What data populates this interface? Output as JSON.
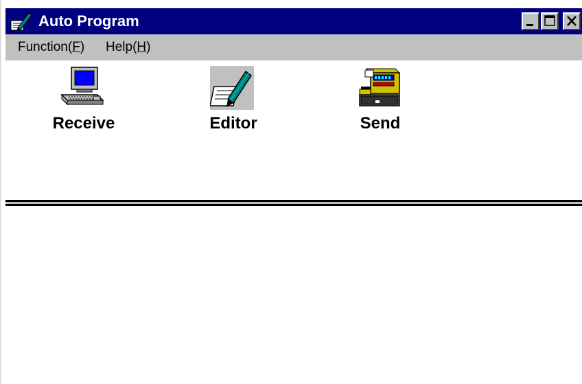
{
  "window": {
    "title": "Auto Program",
    "title_color": "#000080"
  },
  "menu": {
    "function_label": "Function(",
    "function_hotkey": "F",
    "function_close": ")",
    "help_label": "Help(",
    "help_hotkey": "H",
    "help_close": ")"
  },
  "tools": [
    {
      "label": "Receive",
      "icon": "computer-terminal-icon"
    },
    {
      "label": "Editor",
      "icon": "pen-notepad-icon"
    },
    {
      "label": "Send",
      "icon": "cash-register-icon"
    }
  ]
}
